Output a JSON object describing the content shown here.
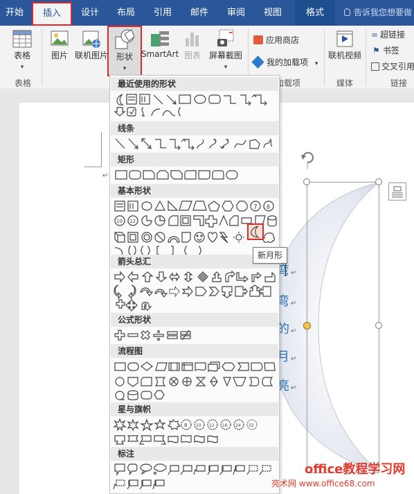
{
  "ribbon_tabs": [
    {
      "label": "开始"
    },
    {
      "label": "插入"
    },
    {
      "label": "设计"
    },
    {
      "label": "布局"
    },
    {
      "label": "引用"
    },
    {
      "label": "邮件"
    },
    {
      "label": "审阅"
    },
    {
      "label": "视图"
    },
    {
      "label": "格式"
    }
  ],
  "tell_me": "告诉我您想要做",
  "ribbon": {
    "table": "表格",
    "picture": "图片",
    "online_picture": "联机图片",
    "shapes": "形状",
    "smartart": "SmartArt",
    "chart": "图表",
    "screenshot": "屏幕截图",
    "app_store": "应用商店",
    "my_addins": "我的加载项",
    "online_video": "联机视频",
    "hyperlink": "超链接",
    "bookmark": "书签",
    "cross_reference": "交叉引用",
    "groups": {
      "tables": "表格",
      "addins": "加载项",
      "media": "媒体",
      "links": "链接"
    }
  },
  "shapes_menu": {
    "sections": [
      {
        "title": "最近使用的形状"
      },
      {
        "title": "线条"
      },
      {
        "title": "矩形"
      },
      {
        "title": "基本形状"
      },
      {
        "title": "箭头总汇"
      },
      {
        "title": "公式形状"
      },
      {
        "title": "流程图"
      },
      {
        "title": "星与旗帜"
      },
      {
        "title": "标注"
      }
    ],
    "tooltip": "新月形"
  },
  "document": {
    "moon_text": [
      "弯",
      "弯",
      "的",
      "月",
      "亮"
    ]
  },
  "watermark": {
    "main": "office教程学习网",
    "sub": "亮术网 www.office68.com"
  },
  "colors": {
    "ribbon_blue": "#2b579a",
    "highlight_red": "#e02a2a",
    "moon_text_blue": "#2e75b6"
  }
}
